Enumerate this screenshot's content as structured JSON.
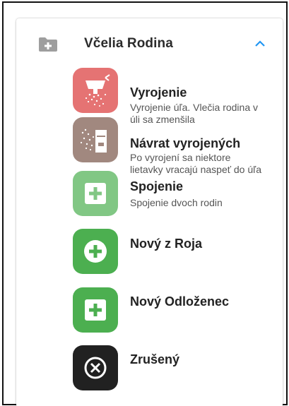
{
  "section": {
    "title": "Včelia Rodina",
    "icon": "folder-plus-icon",
    "toggle_icon": "chevron-up-icon",
    "accent": "#2196F3"
  },
  "items": [
    {
      "title": "Vyrojenie",
      "desc_lines": [
        "Vyrojenie úľa. Vlečia rodina v",
        "úli sa zmenšila"
      ],
      "icon": "swarm-icon",
      "color": "#E57373"
    },
    {
      "title": "Návrat vyrojených",
      "desc_lines": [
        "Po vyrojení sa niektore",
        "lietavky vracajú naspeť do úľa"
      ],
      "icon": "hive-return-icon",
      "color": "#A1887F"
    },
    {
      "title": "Spojenie",
      "desc_lines": [
        "Spojenie dvoch rodin"
      ],
      "icon": "plus-box-icon",
      "color": "#81C784"
    },
    {
      "title": "Nový z Roja",
      "desc_lines": [],
      "icon": "plus-circle-icon",
      "color": "#4CAF50"
    },
    {
      "title": "Nový Odloženec",
      "desc_lines": [],
      "icon": "plus-box-icon",
      "color": "#4CAF50"
    },
    {
      "title": "Zrušený",
      "desc_lines": [],
      "icon": "close-circle-icon",
      "color": "#212121"
    }
  ]
}
